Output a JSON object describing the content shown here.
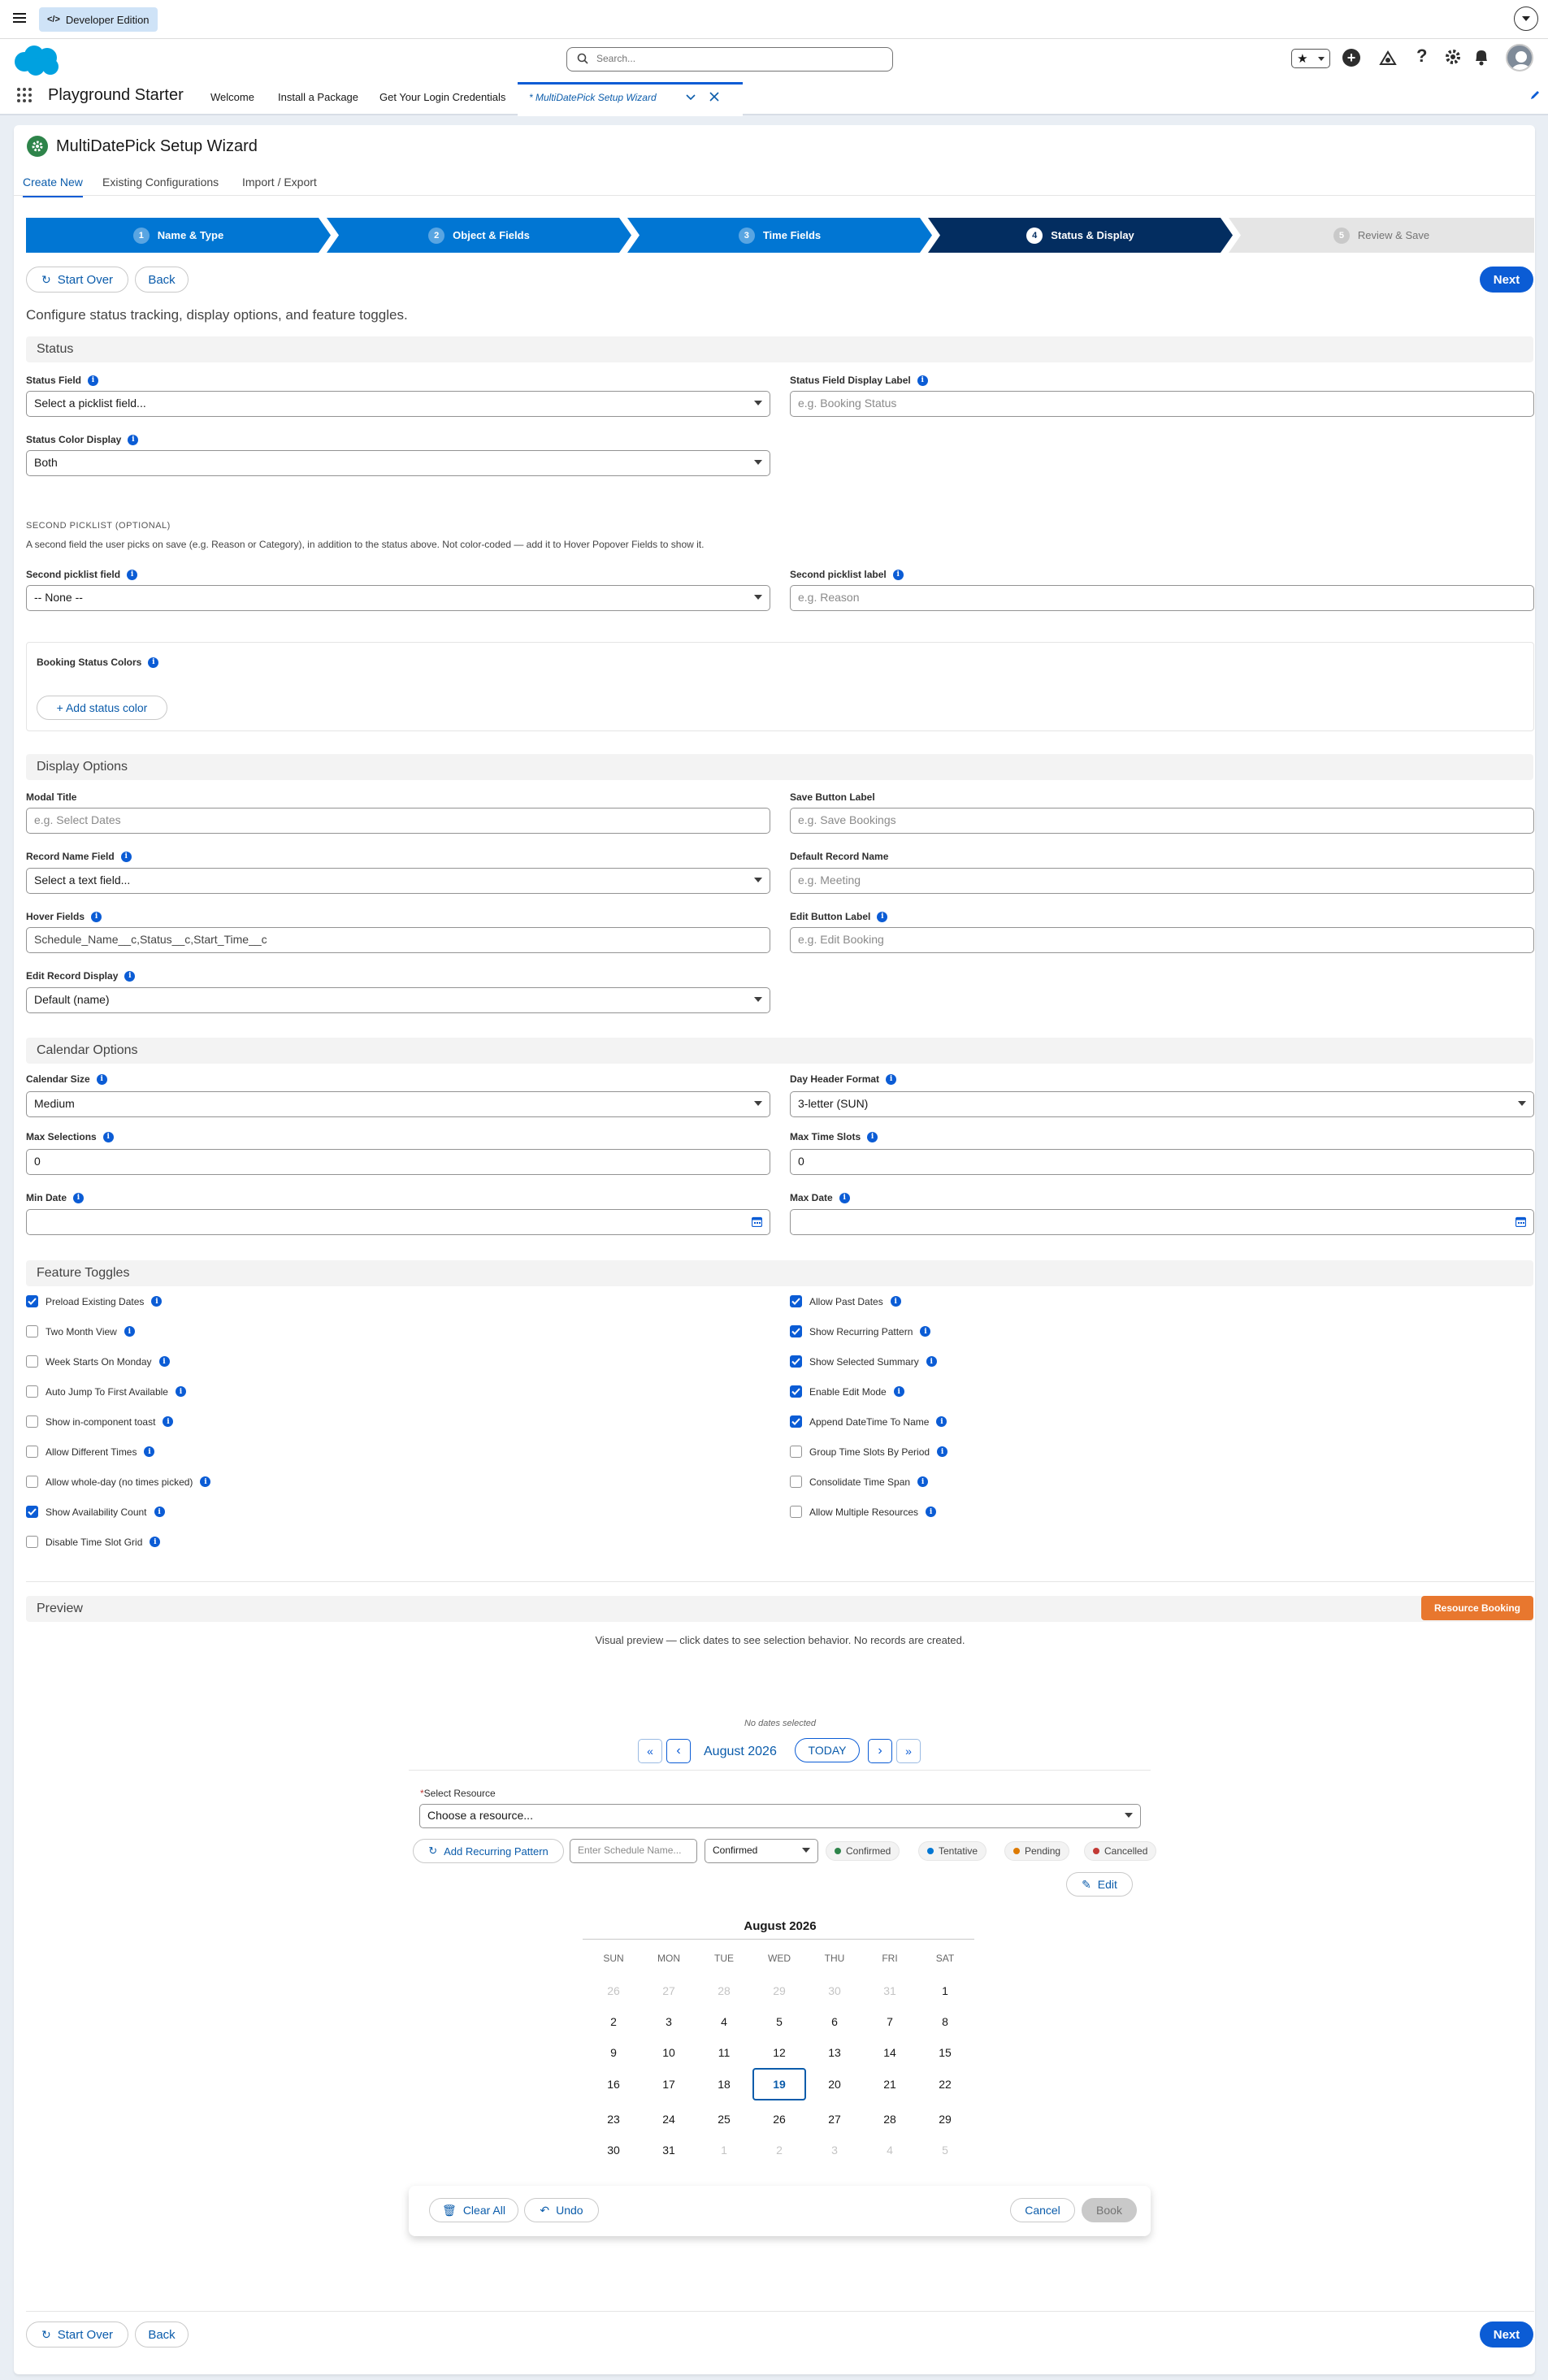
{
  "topbar": {
    "edition": "Developer Edition"
  },
  "header": {
    "search_placeholder": "Search...",
    "app_name": "Playground Starter",
    "nav": [
      "Welcome",
      "Install a Package",
      "Get Your Login Credentials"
    ],
    "active_tab": "* MultiDatePick Setup Wizard"
  },
  "page": {
    "title": "MultiDatePick Setup Wizard",
    "tabs": [
      "Create New",
      "Existing Configurations",
      "Import / Export"
    ],
    "steps": [
      {
        "num": "1",
        "label": "Name & Type"
      },
      {
        "num": "2",
        "label": "Object & Fields"
      },
      {
        "num": "3",
        "label": "Time Fields"
      },
      {
        "num": "4",
        "label": "Status & Display"
      },
      {
        "num": "5",
        "label": "Review & Save"
      }
    ],
    "start_over": "Start Over",
    "back": "Back",
    "next": "Next",
    "intro": "Configure status tracking, display options, and feature toggles."
  },
  "status": {
    "heading": "Status",
    "status_field_label": "Status Field",
    "status_field_value": "Select a picklist field...",
    "status_display_label": "Status Field Display Label",
    "status_display_placeholder": "e.g. Booking Status",
    "color_display_label": "Status Color Display",
    "color_display_value": "Both",
    "second_heading": "SECOND PICKLIST (OPTIONAL)",
    "second_desc": "A second field the user picks on save (e.g. Reason or Category), in addition to the status above. Not color-coded — add it to Hover Popover Fields to show it.",
    "second_field_label": "Second picklist field",
    "second_field_value": "-- None --",
    "second_label_label": "Second picklist label",
    "second_label_placeholder": "e.g. Reason",
    "colors_label": "Booking Status Colors",
    "add_color": "+ Add status color"
  },
  "display": {
    "heading": "Display Options",
    "modal_title_label": "Modal Title",
    "modal_title_placeholder": "e.g. Select Dates",
    "save_label_label": "Save Button Label",
    "save_label_placeholder": "e.g. Save Bookings",
    "record_name_label": "Record Name Field",
    "record_name_value": "Select a text field...",
    "default_name_label": "Default Record Name",
    "default_name_placeholder": "e.g. Meeting",
    "hover_label": "Hover Fields",
    "hover_value": "Schedule_Name__c,Status__c,Start_Time__c",
    "edit_label_label": "Edit Button Label",
    "edit_label_placeholder": "e.g. Edit Booking",
    "edit_display_label": "Edit Record Display",
    "edit_display_value": "Default (name)"
  },
  "calendar_options": {
    "heading": "Calendar Options",
    "size_label": "Calendar Size",
    "size_value": "Medium",
    "day_header_label": "Day Header Format",
    "day_header_value": "3-letter (SUN)",
    "max_sel_label": "Max Selections",
    "max_sel_value": "0",
    "max_slots_label": "Max Time Slots",
    "max_slots_value": "0",
    "min_date_label": "Min Date",
    "max_date_label": "Max Date"
  },
  "toggles": {
    "heading": "Feature Toggles",
    "left": [
      {
        "label": "Preload Existing Dates",
        "on": true
      },
      {
        "label": "Two Month View",
        "on": false
      },
      {
        "label": "Week Starts On Monday",
        "on": false
      },
      {
        "label": "Auto Jump To First Available",
        "on": false
      },
      {
        "label": "Show in-component toast",
        "on": false
      },
      {
        "label": "Allow Different Times",
        "on": false
      },
      {
        "label": "Allow whole-day (no times picked)",
        "on": false
      },
      {
        "label": "Show Availability Count",
        "on": true
      },
      {
        "label": "Disable Time Slot Grid",
        "on": false
      }
    ],
    "right": [
      {
        "label": "Allow Past Dates",
        "on": true
      },
      {
        "label": "Show Recurring Pattern",
        "on": true
      },
      {
        "label": "Show Selected Summary",
        "on": true
      },
      {
        "label": "Enable Edit Mode",
        "on": true
      },
      {
        "label": "Append DateTime To Name",
        "on": true
      },
      {
        "label": "Group Time Slots By Period",
        "on": false
      },
      {
        "label": "Consolidate Time Span",
        "on": false
      },
      {
        "label": "Allow Multiple Resources",
        "on": false
      }
    ]
  },
  "preview": {
    "heading": "Preview",
    "badge": "Resource Booking",
    "hint": "Visual preview — click dates to see selection behavior. No records are created.",
    "no_dates": "No dates selected",
    "month": "August 2026",
    "today": "TODAY",
    "select_resource_label": "Select Resource",
    "resource_placeholder": "Choose a resource...",
    "add_recurring": "Add Recurring Pattern",
    "schedule_placeholder": "Enter Schedule Name...",
    "status_value": "Confirmed",
    "legend": [
      {
        "label": "Confirmed",
        "color": "#2e844a"
      },
      {
        "label": "Tentative",
        "color": "#0176d3"
      },
      {
        "label": "Pending",
        "color": "#dd7a01"
      },
      {
        "label": "Cancelled",
        "color": "#c23934"
      }
    ],
    "edit": "Edit",
    "calendar_title": "August 2026",
    "weekdays": [
      "SUN",
      "MON",
      "TUE",
      "WED",
      "THU",
      "FRI",
      "SAT"
    ],
    "weeks": [
      [
        "26",
        "27",
        "28",
        "29",
        "30",
        "31",
        "1"
      ],
      [
        "2",
        "3",
        "4",
        "5",
        "6",
        "7",
        "8"
      ],
      [
        "9",
        "10",
        "11",
        "12",
        "13",
        "14",
        "15"
      ],
      [
        "16",
        "17",
        "18",
        "19",
        "20",
        "21",
        "22"
      ],
      [
        "23",
        "24",
        "25",
        "26",
        "27",
        "28",
        "29"
      ],
      [
        "30",
        "31",
        "1",
        "2",
        "3",
        "4",
        "5"
      ]
    ],
    "today_day": "19",
    "clear_all": "Clear All",
    "undo": "Undo",
    "cancel": "Cancel",
    "book": "Book"
  },
  "colors": {
    "brand": "#0b5cd5",
    "step_done": "#0176d3",
    "step_active": "#032d60",
    "badge": "#e8772e"
  }
}
